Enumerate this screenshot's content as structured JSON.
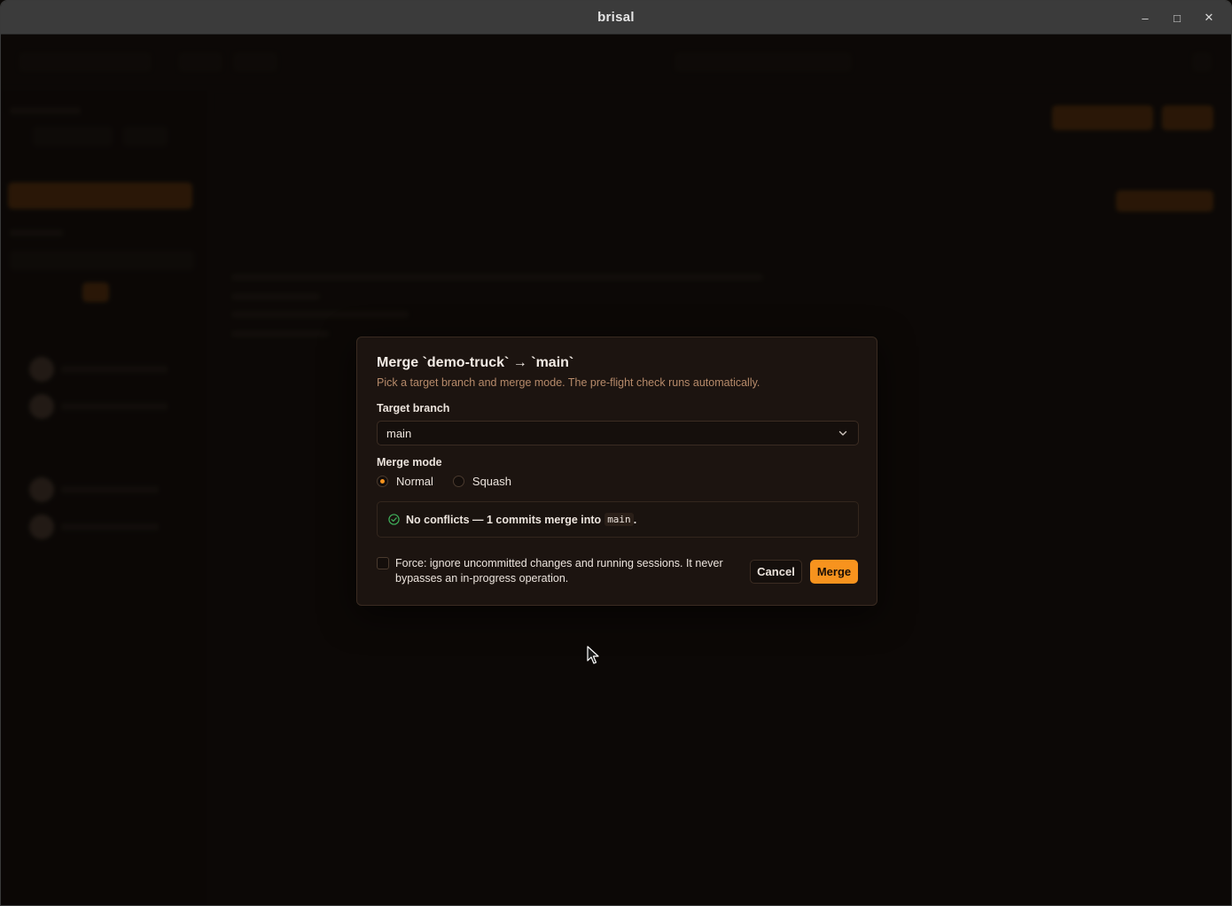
{
  "window": {
    "title": "brisal"
  },
  "dialog": {
    "title": "Merge `demo-truck` → `main`",
    "subtitle": "Pick a target branch and merge mode. The pre-flight check runs automatically.",
    "target_branch_label": "Target branch",
    "target_branch_value": "main",
    "merge_mode_label": "Merge mode",
    "modes": [
      {
        "label": "Normal",
        "selected": true
      },
      {
        "label": "Squash",
        "selected": false
      }
    ],
    "status_text": "No conflicts — 1 commits merge into",
    "status_branch": "main",
    "status_suffix": ".",
    "force_text": "Force: ignore uncommitted changes and running sessions. It never bypasses an in-progress operation.",
    "force_checked": false,
    "cancel_label": "Cancel",
    "merge_label": "Merge"
  },
  "colors": {
    "accent": "#f7931e",
    "success": "#3fae5a",
    "dialog_bg": "#1c1410"
  }
}
